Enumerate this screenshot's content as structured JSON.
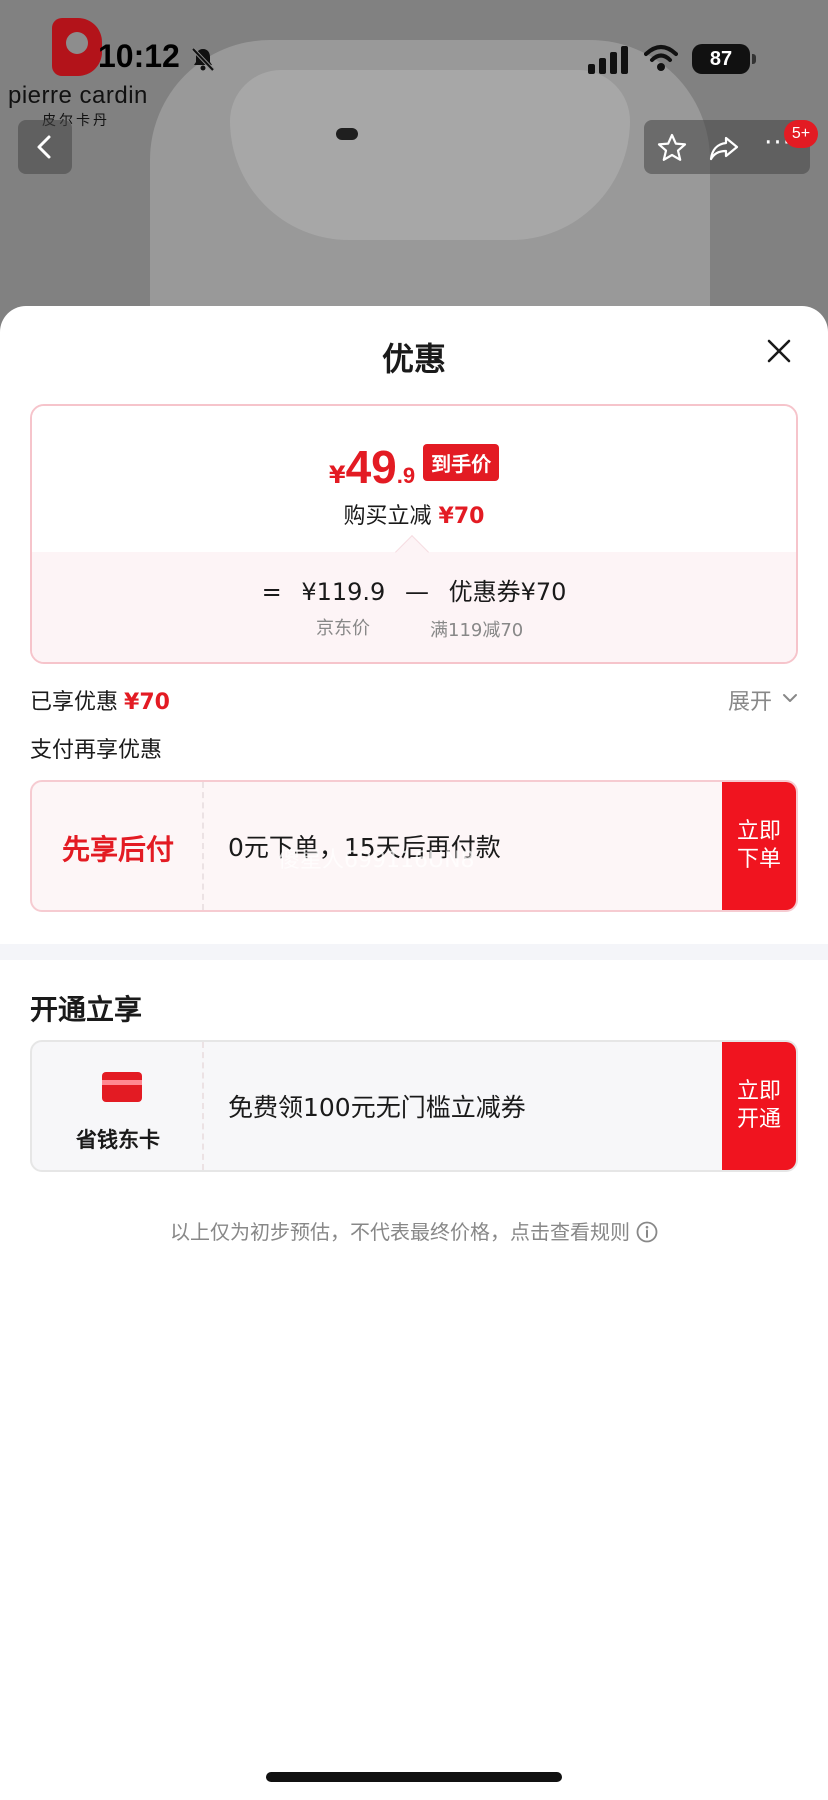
{
  "status_bar": {
    "time": "10:12",
    "battery": "87"
  },
  "brand": {
    "name": "pierre cardin",
    "name_cn": "皮尔卡丹"
  },
  "top_actions": {
    "more_badge": "5+"
  },
  "sheet": {
    "title": "优惠",
    "price_card": {
      "currency": "¥",
      "price_int": "49",
      "price_dec": ".9",
      "price_tag": "到手价",
      "subtitle_prefix": "购买立减",
      "subtitle_amount": "¥70",
      "formula": {
        "eq": "=",
        "jd_price": "¥119.9",
        "minus": "—",
        "coupon": "优惠券¥70"
      },
      "label_jd": "京东价",
      "label_coupon": "满119减70"
    },
    "enjoyed": {
      "label": "已享优惠",
      "amount": "¥70"
    },
    "expand_label": "展开",
    "pay_section_title": "支付再享优惠",
    "pay_card": {
      "left_label": "先享后付",
      "text": "0元下单，15天后再付款",
      "button_line1": "立即",
      "button_line2": "下单",
      "watermark": "傻星人699116UN8"
    },
    "open_section_title": "开通立享",
    "open_card": {
      "left_label": "省钱东卡",
      "text": "免费领100元无门槛立减券",
      "button_line1": "立即",
      "button_line2": "开通"
    },
    "disclaimer": "以上仅为初步预估，不代表最终价格，点击查看规则"
  },
  "colors": {
    "accent_red": "#e31b23",
    "button_red": "#f0141f",
    "muted": "#888888"
  },
  "icons": [
    "bell-mute-icon",
    "signal-icon",
    "wifi-icon",
    "back-chevron-icon",
    "star-icon",
    "share-icon",
    "more-icon",
    "close-icon",
    "chevron-down-icon",
    "card-icon",
    "info-icon"
  ]
}
